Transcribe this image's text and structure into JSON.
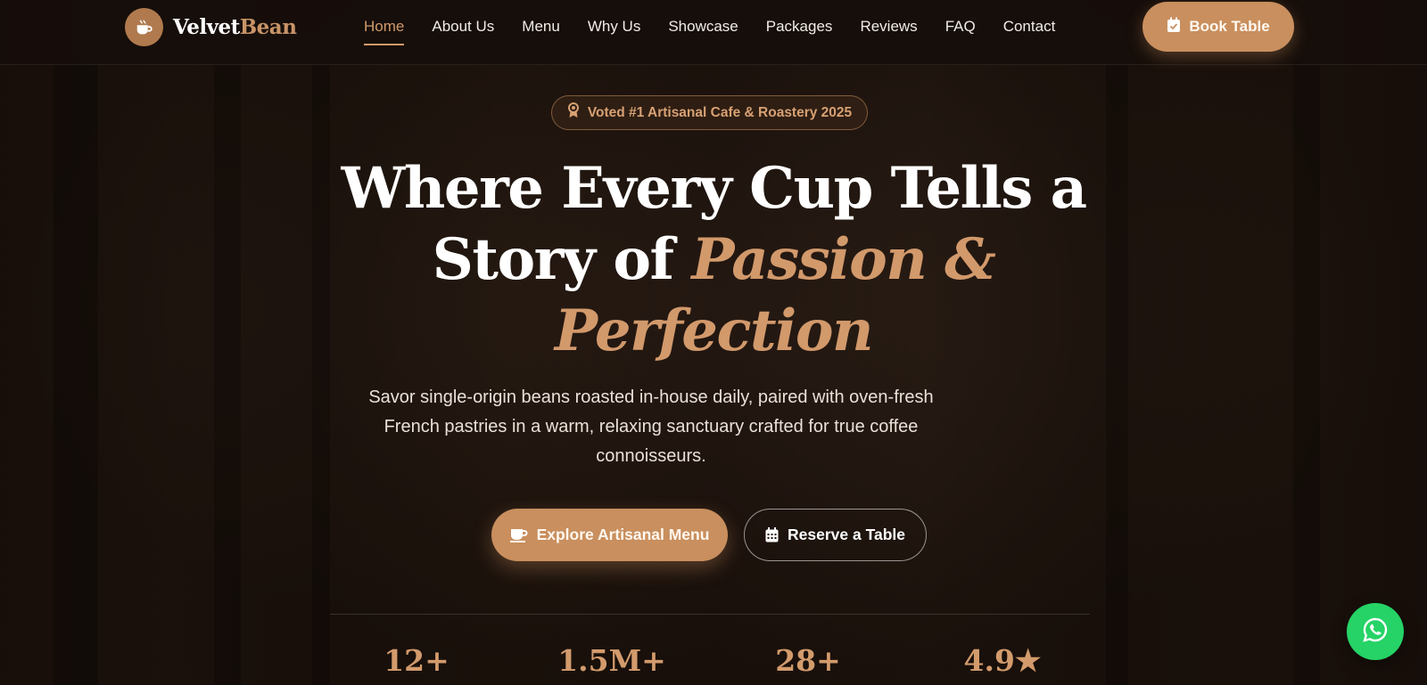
{
  "brand": {
    "name_part1": "Velvet",
    "name_part2": "Bean"
  },
  "nav": {
    "items": [
      {
        "label": "Home",
        "active": true
      },
      {
        "label": "About Us"
      },
      {
        "label": "Menu"
      },
      {
        "label": "Why Us"
      },
      {
        "label": "Showcase"
      },
      {
        "label": "Packages"
      },
      {
        "label": "Reviews"
      },
      {
        "label": "FAQ"
      },
      {
        "label": "Contact"
      }
    ],
    "book_label": "Book Table"
  },
  "hero": {
    "badge": "Voted #1 Artisanal Cafe & Roastery 2025",
    "headline_line1": "Where Every Cup Tells a",
    "headline_line2_plain": "Story of ",
    "headline_line2_accent": "Passion &",
    "headline_line3_accent": "Perfection",
    "subtitle": "Savor single-origin beans roasted in-house daily, paired with oven-fresh French pastries in a warm, relaxing sanctuary crafted for true coffee connoisseurs.",
    "cta_primary": "Explore Artisanal Menu",
    "cta_secondary": "Reserve a Table"
  },
  "stats": [
    {
      "value": "12+"
    },
    {
      "value": "1.5M+"
    },
    {
      "value": "28+"
    },
    {
      "value": "4.9★"
    }
  ],
  "colors": {
    "accent": "#c98f5e",
    "background": "#1c120d",
    "whatsapp": "#25d366"
  },
  "icons": {
    "logo": "coffee-cup-icon",
    "book": "calendar-check-icon",
    "badge": "award-icon",
    "cta_primary": "coffee-icon",
    "cta_secondary": "calendar-icon",
    "floating": "whatsapp-icon"
  }
}
